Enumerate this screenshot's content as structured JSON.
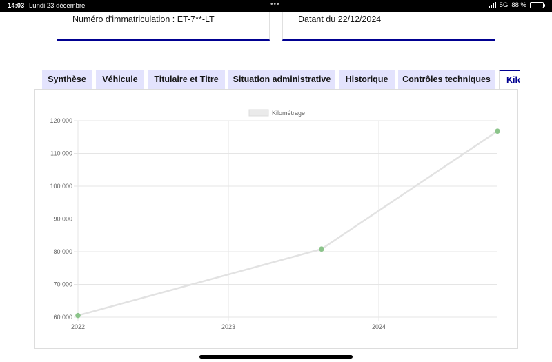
{
  "status_bar": {
    "time": "14:03",
    "date": "Lundi 23 décembre",
    "network": "5G",
    "battery": "88 %",
    "battery_level": 0.88
  },
  "cards": {
    "registration": "Numéro d'immatriculation : ET-7**-LT",
    "dated": "Datant du 22/12/2024"
  },
  "tabs": [
    {
      "label": "Synthèse"
    },
    {
      "label": "Véhicule"
    },
    {
      "label": "Titulaire et Titre"
    },
    {
      "label": "Situation administrative"
    },
    {
      "label": "Historique"
    },
    {
      "label": "Contrôles techniques"
    },
    {
      "label": "Kilométrage"
    }
  ],
  "active_tab": 6,
  "chart_data": {
    "type": "line",
    "legend": [
      "Kilométrage"
    ],
    "series": [
      {
        "name": "Kilométrage",
        "points": [
          {
            "x": "2022-01-01",
            "y": 60500
          },
          {
            "x": "2023-08-15",
            "y": 80800
          },
          {
            "x": "2024-10-15",
            "y": 116800
          }
        ]
      }
    ],
    "x_ticks": [
      "2022",
      "2023",
      "2024"
    ],
    "x_range": [
      "2022-01-01",
      "2024-10-15"
    ],
    "y_ticks": [
      "60 000",
      "70 000",
      "80 000",
      "90 000",
      "100 000",
      "110 000",
      "120 000"
    ],
    "ylim": [
      60000,
      120000
    ],
    "grid": true,
    "legend_position": "top",
    "line_color": "#e2e2e2",
    "point_color": "#8bc48a"
  }
}
